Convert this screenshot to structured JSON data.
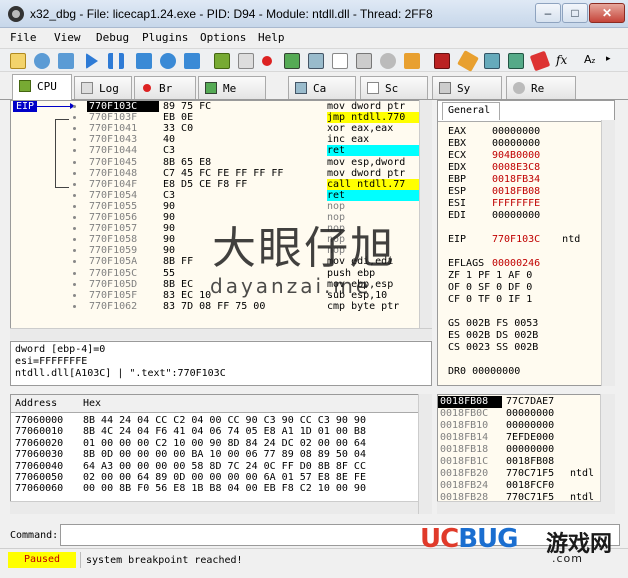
{
  "window": {
    "title": "x32_dbg - File: licecap1.24.exe - PID: D94 - Module: ntdll.dll - Thread: 2FF8",
    "min": "–",
    "max": "□",
    "close": "✕"
  },
  "menu": [
    "File",
    "View",
    "Debug",
    "Plugins",
    "Options",
    "Help"
  ],
  "tabs": [
    "CPU",
    "Log",
    "Br",
    "Me",
    "Ca",
    "Sc",
    "Sy",
    "Re"
  ],
  "disasm": {
    "eip_label": "EIP",
    "rows": [
      {
        "addr": "770F103C",
        "bytes": "89 75 FC",
        "asm": "mov dword ptr",
        "style": "current"
      },
      {
        "addr": "770F103F",
        "bytes": "EB 0E",
        "asm": "jmp ntdll.770",
        "style": "jmp"
      },
      {
        "addr": "770F1041",
        "bytes": "33 C0",
        "asm": "xor eax,eax",
        "style": ""
      },
      {
        "addr": "770F1043",
        "bytes": "40",
        "asm": "inc eax",
        "style": ""
      },
      {
        "addr": "770F1044",
        "bytes": "C3",
        "asm": "ret",
        "style": "ret"
      },
      {
        "addr": "770F1045",
        "bytes": "8B 65 E8",
        "asm": "mov esp,dword",
        "style": ""
      },
      {
        "addr": "770F1048",
        "bytes": "C7 45 FC FE FF FF FF",
        "asm": "mov dword ptr",
        "style": ""
      },
      {
        "addr": "770F104F",
        "bytes": "E8 D5 CE F8 FF",
        "asm": "call ntdll.77",
        "style": "call"
      },
      {
        "addr": "770F1054",
        "bytes": "C3",
        "asm": "ret",
        "style": "ret"
      },
      {
        "addr": "770F1055",
        "bytes": "90",
        "asm": "nop",
        "style": "nop"
      },
      {
        "addr": "770F1056",
        "bytes": "90",
        "asm": "nop",
        "style": "nop"
      },
      {
        "addr": "770F1057",
        "bytes": "90",
        "asm": "nop",
        "style": "nop"
      },
      {
        "addr": "770F1058",
        "bytes": "90",
        "asm": "nop",
        "style": "nop"
      },
      {
        "addr": "770F1059",
        "bytes": "90",
        "asm": "nop",
        "style": "nop"
      },
      {
        "addr": "770F105A",
        "bytes": "8B FF",
        "asm": "mov edi,edi",
        "style": ""
      },
      {
        "addr": "770F105C",
        "bytes": "55",
        "asm": "push ebp",
        "style": ""
      },
      {
        "addr": "770F105D",
        "bytes": "8B EC",
        "asm": "mov ebp,esp",
        "style": ""
      },
      {
        "addr": "770F105F",
        "bytes": "83 EC 10",
        "asm": "sub esp,10",
        "style": ""
      },
      {
        "addr": "770F1062",
        "bytes": "83 7D 08 FF 75 00",
        "asm": "cmp byte ptr",
        "style": ""
      }
    ]
  },
  "info": [
    "dword [ebp-4]=0",
    "esi=FFFFFFFE",
    "ntdll.dll[A103C] | \".text\":770F103C"
  ],
  "registers": {
    "tab": "General",
    "rows": [
      {
        "name": "EAX",
        "value": "00000000",
        "color": "blk"
      },
      {
        "name": "EBX",
        "value": "00000000",
        "color": "blk"
      },
      {
        "name": "ECX",
        "value": "904B0000",
        "color": "red"
      },
      {
        "name": "EDX",
        "value": "0008E3C8",
        "color": "red"
      },
      {
        "name": "EBP",
        "value": "0018FB34",
        "color": "red"
      },
      {
        "name": "ESP",
        "value": "0018FB08",
        "color": "red"
      },
      {
        "name": "ESI",
        "value": "FFFFFFFE",
        "color": "red"
      },
      {
        "name": "EDI",
        "value": "00000000",
        "color": "blk"
      }
    ],
    "eip": {
      "name": "EIP",
      "value": "770F103C",
      "extra": "ntd"
    },
    "eflags": {
      "name": "EFLAGS",
      "value": "00000246"
    },
    "flags": [
      "ZF 1  PF 1  AF 0",
      "OF 0  SF 0  DF 0",
      "CF 0  TF 0  IF 1"
    ],
    "segs": [
      "GS 002B  FS 0053",
      "ES 002B  DS 002B",
      "CS 0023  SS 002B"
    ],
    "dr0": "DR0 00000000"
  },
  "dump": {
    "col_address": "Address",
    "col_hex": "Hex",
    "rows": [
      {
        "addr": "77060000",
        "hex": "8B 44 24 04 CC C2 04 00 CC 90 C3 90 CC C3 90 90"
      },
      {
        "addr": "77060010",
        "hex": "8B 4C 24 04 F6 41 04 06 74 05 E8 A1 1D 01 00 B8"
      },
      {
        "addr": "77060020",
        "hex": "01 00 00 00 C2 10 00 90 8D 84 24 DC 02 00 00 64"
      },
      {
        "addr": "77060030",
        "hex": "8B 0D 00 00 00 00 BA 10 00 06 77 89 08 89 50 04"
      },
      {
        "addr": "77060040",
        "hex": "64 A3 00 00 00 00 58 8D 7C 24 0C FF D0 8B 8F CC"
      },
      {
        "addr": "77060050",
        "hex": "02 00 00 64 89 0D 00 00 00 00 6A 01 57 E8 8E FE"
      },
      {
        "addr": "77060060",
        "hex": "00 00 8B F0 56 E8 1B B8 04 00 EB F8 C2 10 00 90"
      }
    ]
  },
  "stack": {
    "rows": [
      {
        "addr": "0018FB08",
        "val": "77C7DAE7",
        "com": ""
      },
      {
        "addr": "0018FB0C",
        "val": "00000000",
        "com": ""
      },
      {
        "addr": "0018FB10",
        "val": "00000000",
        "com": ""
      },
      {
        "addr": "0018FB14",
        "val": "7EFDE000",
        "com": ""
      },
      {
        "addr": "0018FB18",
        "val": "00000000",
        "com": ""
      },
      {
        "addr": "0018FB1C",
        "val": "0018FB08",
        "com": ""
      },
      {
        "addr": "0018FB20",
        "val": "770C71F5",
        "com": "ntdl"
      },
      {
        "addr": "0018FB24",
        "val": "0018FCF0",
        "com": ""
      },
      {
        "addr": "0018FB28",
        "val": "770C71F5",
        "com": "ntdl"
      }
    ]
  },
  "command": {
    "label": "Command:",
    "value": ""
  },
  "status": {
    "state": "Paused",
    "message": "system breakpoint reached!"
  },
  "watermark": {
    "center_big": "大眼仔旭",
    "center_small": "dayanzai.me",
    "uc": "UC",
    "bug": "BUG",
    "cn": "游戏网",
    "com": ".com"
  }
}
